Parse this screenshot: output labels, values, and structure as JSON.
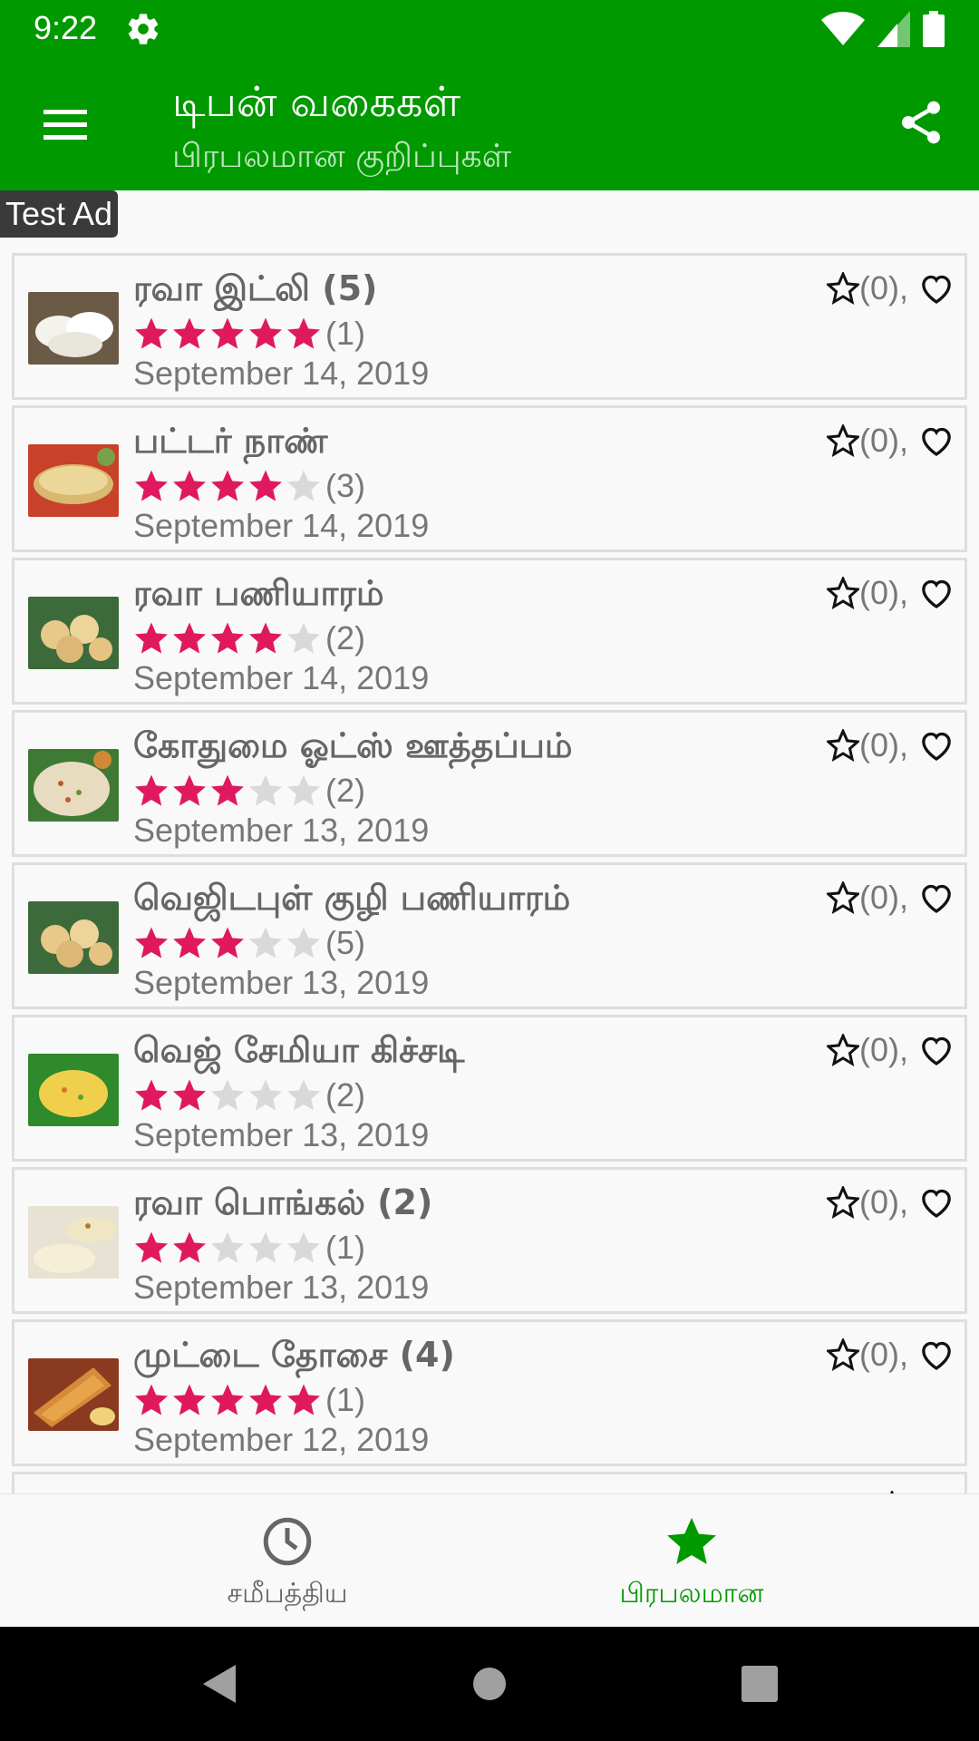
{
  "status": {
    "time": "9:22"
  },
  "appbar": {
    "title": "டிபன் வகைகள்",
    "subtitle": "பிரபலமான குறிப்புகள்"
  },
  "ad": {
    "label": "Test Ad"
  },
  "colors": {
    "primary": "#009900",
    "accent": "#e0195f",
    "star_empty": "#d9d9d9"
  },
  "recipes": [
    {
      "title": "ரவா இட்லி (5)",
      "rating": 5,
      "rating_count": "(1)",
      "date": "September 14, 2019",
      "fav_count": "(0),",
      "image": "idli"
    },
    {
      "title": "பட்டர் நாண்",
      "rating": 4,
      "rating_count": "(3)",
      "date": "September 14, 2019",
      "fav_count": "(0),",
      "image": "naan"
    },
    {
      "title": "ரவா பணியாரம்",
      "rating": 4,
      "rating_count": "(2)",
      "date": "September 14, 2019",
      "fav_count": "(0),",
      "image": "paniyaram"
    },
    {
      "title": "கோதுமை ஓட்ஸ் ஊத்தப்பம்",
      "rating": 3,
      "rating_count": "(2)",
      "date": "September 13, 2019",
      "fav_count": "(0),",
      "image": "uthappam"
    },
    {
      "title": "வெஜிடபுள் குழி பணியாரம்",
      "rating": 3,
      "rating_count": "(5)",
      "date": "September 13, 2019",
      "fav_count": "(0),",
      "image": "paniyaram"
    },
    {
      "title": "வெஜ் சேமியா கிச்சடி",
      "rating": 2,
      "rating_count": "(2)",
      "date": "September 13, 2019",
      "fav_count": "(0),",
      "image": "kichadi"
    },
    {
      "title": "ரவா பொங்கல் (2)",
      "rating": 2,
      "rating_count": "(1)",
      "date": "September 13, 2019",
      "fav_count": "(0),",
      "image": "pongal"
    },
    {
      "title": "முட்டை தோசை (4)",
      "rating": 5,
      "rating_count": "(1)",
      "date": "September 12, 2019",
      "fav_count": "(0),",
      "image": "dosa"
    },
    {
      "title": "",
      "rating": 0,
      "rating_count": "",
      "date": "",
      "fav_count": "",
      "image": "partial"
    }
  ],
  "bottom_nav": [
    {
      "label": "சமீபத்திய",
      "icon": "clock-icon",
      "active": false
    },
    {
      "label": "பிரபலமான",
      "icon": "star-icon",
      "active": true
    }
  ]
}
